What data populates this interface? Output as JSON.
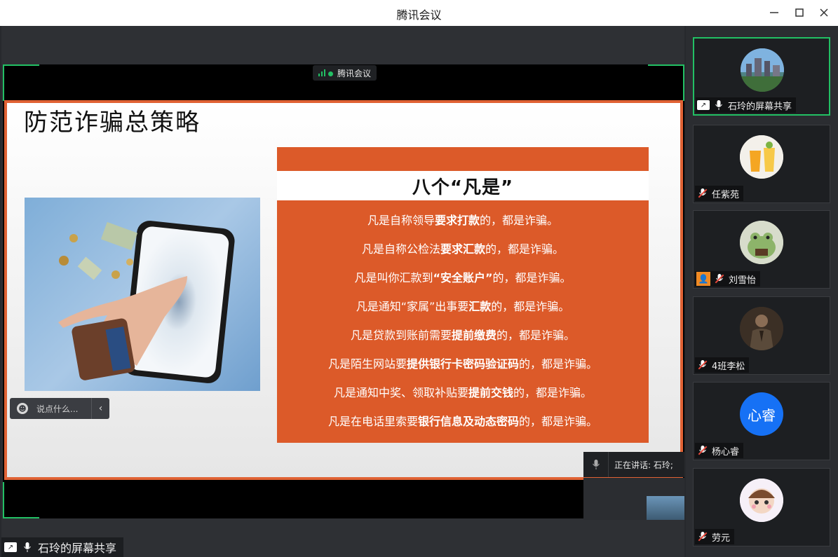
{
  "window": {
    "title": "腾讯会议",
    "minimize_icon": "minimize-icon",
    "maximize_icon": "maximize-icon",
    "close_icon": "close-icon"
  },
  "share": {
    "badge": "腾讯会议",
    "bottom_label": "石玲的屏幕共享",
    "speaking": "正在讲话: 石玲;"
  },
  "slide": {
    "title": "防范诈骗总策略",
    "heading": "八个“凡是”",
    "rules": [
      {
        "pre": "凡是自称领导",
        "bold": "要求打款",
        "post": "的，都是诈骗。"
      },
      {
        "pre": "凡是自称公检法",
        "bold": "要求汇款",
        "post": "的，都是诈骗。"
      },
      {
        "pre": "凡是叫你汇款到",
        "bold": "“安全账户”",
        "post": "的，都是诈骗。"
      },
      {
        "pre": "凡是通知“家属”出事要",
        "bold": "汇款",
        "post": "的，都是诈骗。"
      },
      {
        "pre": "凡是贷款到账前需要",
        "bold": "提前缴费",
        "post": "的，都是诈骗。"
      },
      {
        "pre": "凡是陌生网站要",
        "bold": "提供银行卡密码验证码",
        "post": "的，都是诈骗。"
      },
      {
        "pre": "凡是通知中奖、领取补贴要",
        "bold": "提前交钱",
        "post": "的，都是诈骗。"
      },
      {
        "pre": "凡是在电话里索要",
        "bold": "银行信息及动态密码",
        "post": "的，都是诈骗。"
      }
    ]
  },
  "chat": {
    "placeholder": "说点什么...",
    "collapse_icon": "chevron-left-icon"
  },
  "participants": [
    {
      "name": "石玲的屏幕共享",
      "active": true
    },
    {
      "name": "任紫苑"
    },
    {
      "name": "刘雪怡"
    },
    {
      "name": "4班李松"
    },
    {
      "name": "杨心睿",
      "avatar_text": "心睿"
    },
    {
      "name": "劳元"
    }
  ],
  "colors": {
    "accent_green": "#22c064",
    "slide_orange": "#dc5a29",
    "avatar_blue": "#1671f5",
    "muted_red": "#e8483b",
    "host_orange": "#f08a24"
  }
}
